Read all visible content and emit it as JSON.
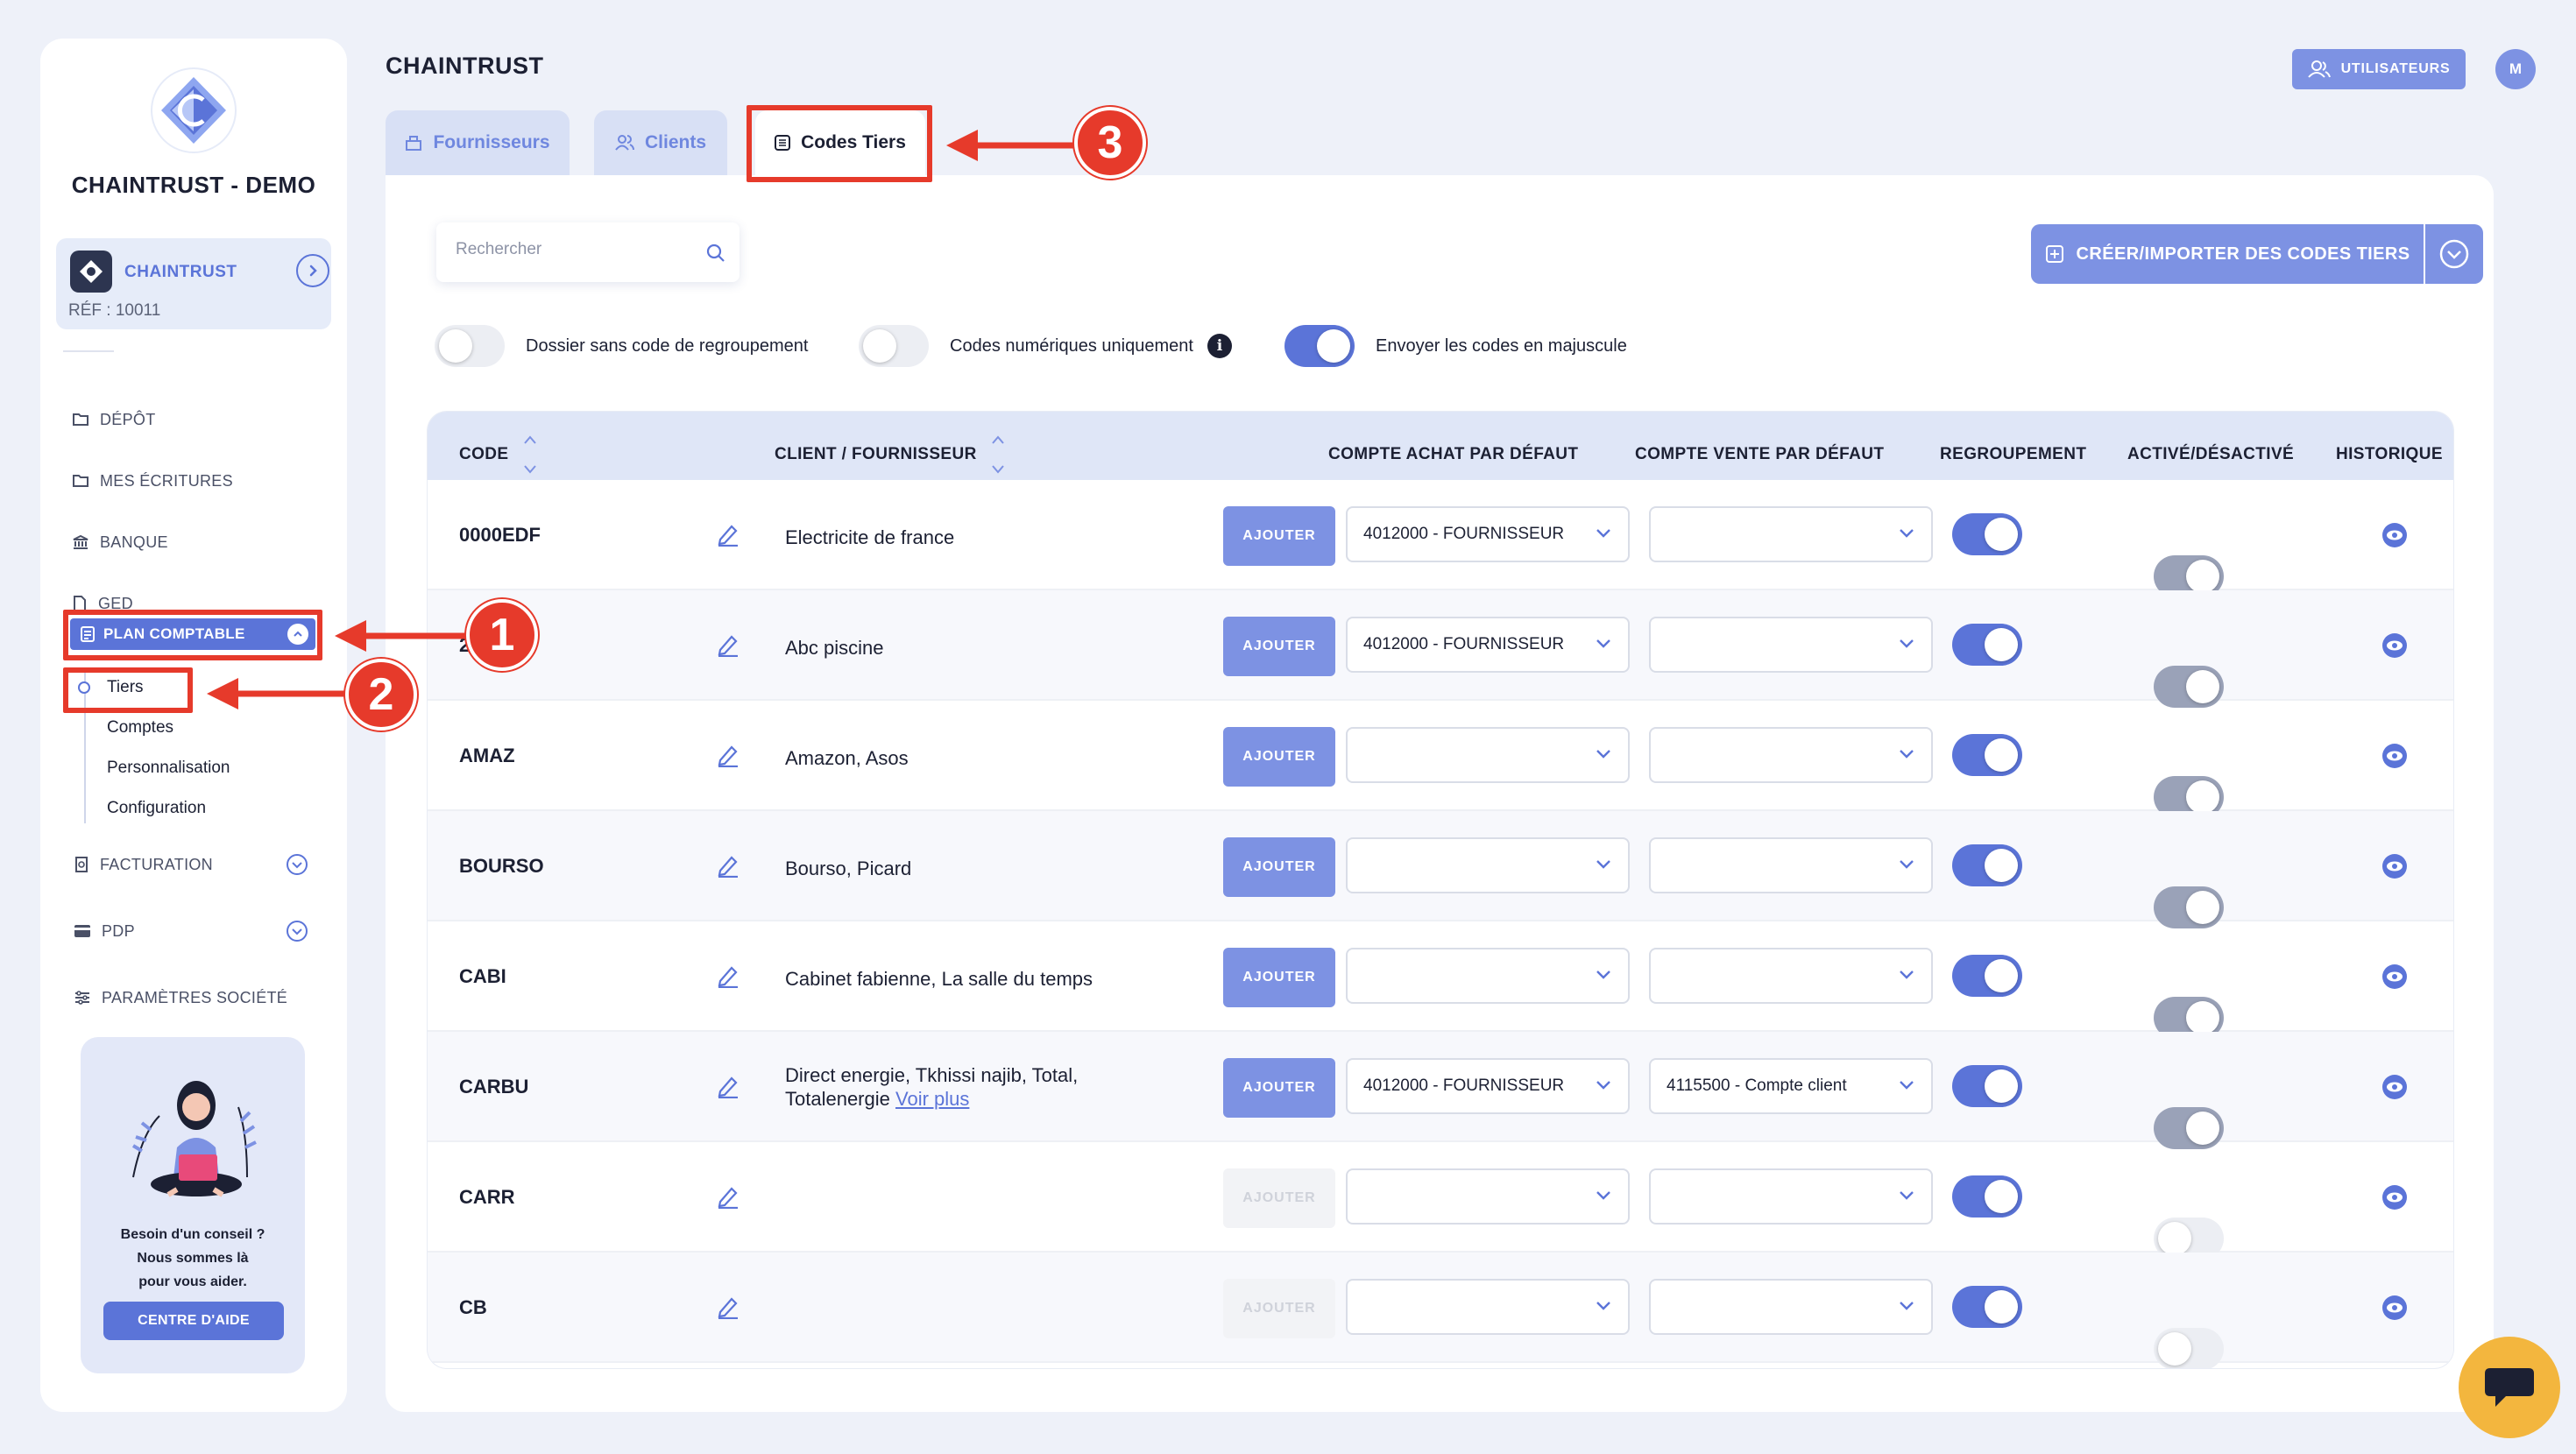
{
  "sidebar": {
    "org_name": "CHAINTRUST - DEMO",
    "account": {
      "name": "CHAINTRUST",
      "ref": "RÉF : 10011"
    },
    "nav": [
      {
        "label": "DÉPÔT",
        "icon": "folder-icon"
      },
      {
        "label": "MES ÉCRITURES",
        "icon": "folder-icon"
      },
      {
        "label": "BANQUE",
        "icon": "bank-icon"
      },
      {
        "label": "GED",
        "icon": "document-icon"
      }
    ],
    "plan_comptable": "PLAN COMPTABLE",
    "sub_items": [
      "Tiers",
      "Comptes",
      "Personnalisation",
      "Configuration"
    ],
    "nav2": [
      {
        "label": "FACTURATION",
        "icon": "invoice-icon"
      },
      {
        "label": "PDP",
        "icon": "card-icon"
      },
      {
        "label": "PARAMÈTRES SOCIÉTÉ",
        "icon": "sliders-icon"
      }
    ],
    "help": {
      "line1": "Besoin d'un conseil ?",
      "line2": "Nous sommes là",
      "line3": "pour vous aider.",
      "button": "CENTRE D'AIDE"
    }
  },
  "header": {
    "title": "CHAINTRUST",
    "users_button": "UTILISATEURS",
    "avatar": "M"
  },
  "tabs": [
    {
      "label": "Fournisseurs",
      "icon": "building-icon"
    },
    {
      "label": "Clients",
      "icon": "users-icon"
    },
    {
      "label": "Codes Tiers",
      "icon": "list-icon"
    }
  ],
  "search": {
    "placeholder": "Rechercher"
  },
  "create_button": "CRÉER/IMPORTER DES CODES TIERS",
  "options": [
    {
      "label": "Dossier sans code de regroupement",
      "state": "off"
    },
    {
      "label": "Codes numériques uniquement",
      "state": "off"
    },
    {
      "label": "Envoyer les codes en majuscule",
      "state": "on"
    }
  ],
  "table": {
    "columns": [
      "CODE",
      "CLIENT / FOURNISSEUR",
      "COMPTE ACHAT PAR DÉFAUT",
      "COMPTE VENTE PAR DÉFAUT",
      "REGROUPEMENT",
      "ACTIVÉ/DÉSACTIVÉ",
      "HISTORIQUE"
    ],
    "add_label": "AJOUTER",
    "see_more": "Voir plus",
    "rows": [
      {
        "code": "0000EDF",
        "client": "Electricite de france",
        "client2": "",
        "achat": "4012000 - FOURNISSEUR",
        "vente": "",
        "add_enabled": true,
        "regroup": true,
        "active": "grey"
      },
      {
        "code": "2",
        "client": "Abc piscine",
        "client2": "",
        "achat": "4012000 - FOURNISSEUR",
        "vente": "",
        "add_enabled": true,
        "regroup": true,
        "active": "grey"
      },
      {
        "code": "AMAZ",
        "client": "Amazon, Asos",
        "client2": "",
        "achat": "",
        "vente": "",
        "add_enabled": true,
        "regroup": true,
        "active": "grey"
      },
      {
        "code": "BOURSO",
        "client": "Bourso, Picard",
        "client2": "",
        "achat": "",
        "vente": "",
        "add_enabled": true,
        "regroup": true,
        "active": "grey"
      },
      {
        "code": "CABI",
        "client": "Cabinet fabienne, La salle du temps",
        "client2": "",
        "achat": "",
        "vente": "",
        "add_enabled": true,
        "regroup": true,
        "active": "grey"
      },
      {
        "code": "CARBU",
        "client": "Direct energie, Tkhissi najib, Total,",
        "client2": "Totalenergie",
        "achat": "4012000 - FOURNISSEUR",
        "vente": "4115500 - Compte client",
        "add_enabled": true,
        "regroup": true,
        "active": "grey"
      },
      {
        "code": "CARR",
        "client": "",
        "client2": "",
        "achat": "",
        "vente": "",
        "add_enabled": false,
        "regroup": true,
        "active": "off"
      },
      {
        "code": "CB",
        "client": "",
        "client2": "",
        "achat": "",
        "vente": "",
        "add_enabled": false,
        "regroup": true,
        "active": "off"
      }
    ]
  },
  "annotations": [
    "1",
    "2",
    "3"
  ],
  "colors": {
    "accent": "#5b74d8",
    "accent_light": "#7d92e3",
    "annotation": "#e63a2b",
    "chat": "#f3b63e",
    "background": "#eef1f9"
  }
}
